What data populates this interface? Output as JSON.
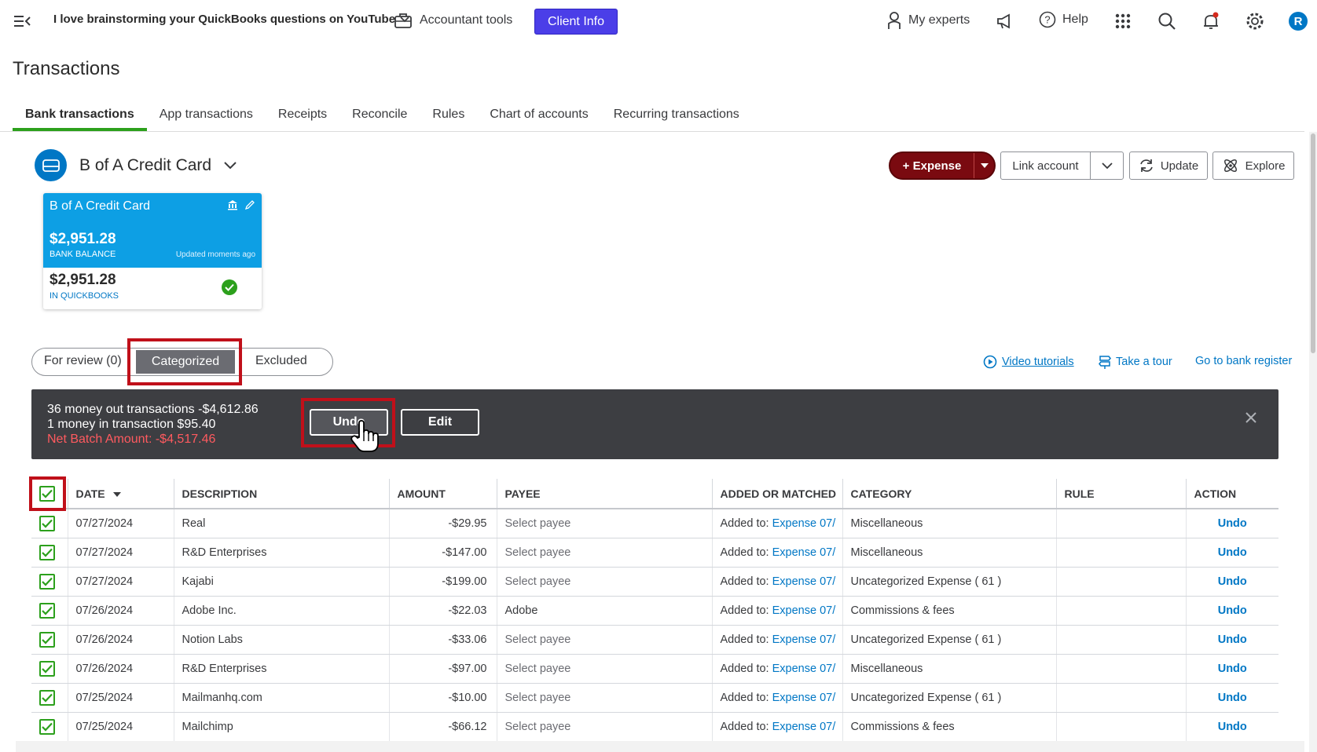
{
  "header": {
    "company": "I love brainstorming your QuickBooks questions on YouTube",
    "accountant_tools": "Accountant tools",
    "client_info": "Client Info",
    "my_experts": "My experts",
    "help": "Help",
    "avatar_letter": "R"
  },
  "page_title": "Transactions",
  "tabs": [
    {
      "label": "Bank transactions",
      "active": true
    },
    {
      "label": "App transactions"
    },
    {
      "label": "Receipts"
    },
    {
      "label": "Reconcile"
    },
    {
      "label": "Rules"
    },
    {
      "label": "Chart of accounts"
    },
    {
      "label": "Recurring transactions"
    }
  ],
  "account": {
    "selected": "B of A Credit Card",
    "card": {
      "name": "B of A Credit Card",
      "bank_balance": "$2,951.28",
      "bank_balance_label": "BANK BALANCE",
      "updated": "Updated moments ago",
      "qb_balance": "$2,951.28",
      "qb_label": "IN QUICKBOOKS"
    }
  },
  "actions": {
    "expense": "+ Expense",
    "link_account": "Link account",
    "update": "Update",
    "explore": "Explore"
  },
  "filter": {
    "for_review": "For review (0)",
    "categorized": "Categorized",
    "excluded": "Excluded"
  },
  "links": {
    "video_tutorials": "Video tutorials",
    "take_tour": "Take a tour",
    "bank_register": "Go to bank register"
  },
  "banner": {
    "line1": "36 money out transactions -$4,612.86",
    "line2": "1 money in transaction $95.40",
    "line3": "Net Batch Amount: -$4,517.46",
    "undo": "Undo",
    "edit": "Edit"
  },
  "table": {
    "headers": {
      "date": "DATE",
      "description": "DESCRIPTION",
      "amount": "AMOUNT",
      "payee": "PAYEE",
      "added": "ADDED OR MATCHED",
      "category": "CATEGORY",
      "rule": "RULE",
      "action": "ACTION"
    },
    "added_prefix": "Added to:",
    "rows": [
      {
        "date": "07/27/2024",
        "description": "Real",
        "amount": "-$29.95",
        "payee": "Select payee",
        "added_link": "Expense 07/",
        "category": "Miscellaneous",
        "action": "Undo"
      },
      {
        "date": "07/27/2024",
        "description": "R&D Enterprises",
        "amount": "-$147.00",
        "payee": "Select payee",
        "added_link": "Expense 07/",
        "category": "Miscellaneous",
        "action": "Undo"
      },
      {
        "date": "07/27/2024",
        "description": "Kajabi",
        "amount": "-$199.00",
        "payee": "Select payee",
        "added_link": "Expense 07/",
        "category": "Uncategorized Expense ( 61 )",
        "action": "Undo"
      },
      {
        "date": "07/26/2024",
        "description": "Adobe Inc.",
        "amount": "-$22.03",
        "payee": "Adobe",
        "added_link": "Expense 07/",
        "category": "Commissions & fees",
        "action": "Undo"
      },
      {
        "date": "07/26/2024",
        "description": "Notion Labs",
        "amount": "-$33.06",
        "payee": "Select payee",
        "added_link": "Expense 07/",
        "category": "Uncategorized Expense ( 61 )",
        "action": "Undo"
      },
      {
        "date": "07/26/2024",
        "description": "R&D Enterprises",
        "amount": "-$97.00",
        "payee": "Select payee",
        "added_link": "Expense 07/",
        "category": "Miscellaneous",
        "action": "Undo"
      },
      {
        "date": "07/25/2024",
        "description": "Mailmanhq.com",
        "amount": "-$10.00",
        "payee": "Select payee",
        "added_link": "Expense 07/",
        "category": "Uncategorized Expense ( 61 )",
        "action": "Undo"
      },
      {
        "date": "07/25/2024",
        "description": "Mailchimp",
        "amount": "-$66.12",
        "payee": "Select payee",
        "added_link": "Expense 07/",
        "category": "Commissions & fees",
        "action": "Undo"
      }
    ]
  }
}
